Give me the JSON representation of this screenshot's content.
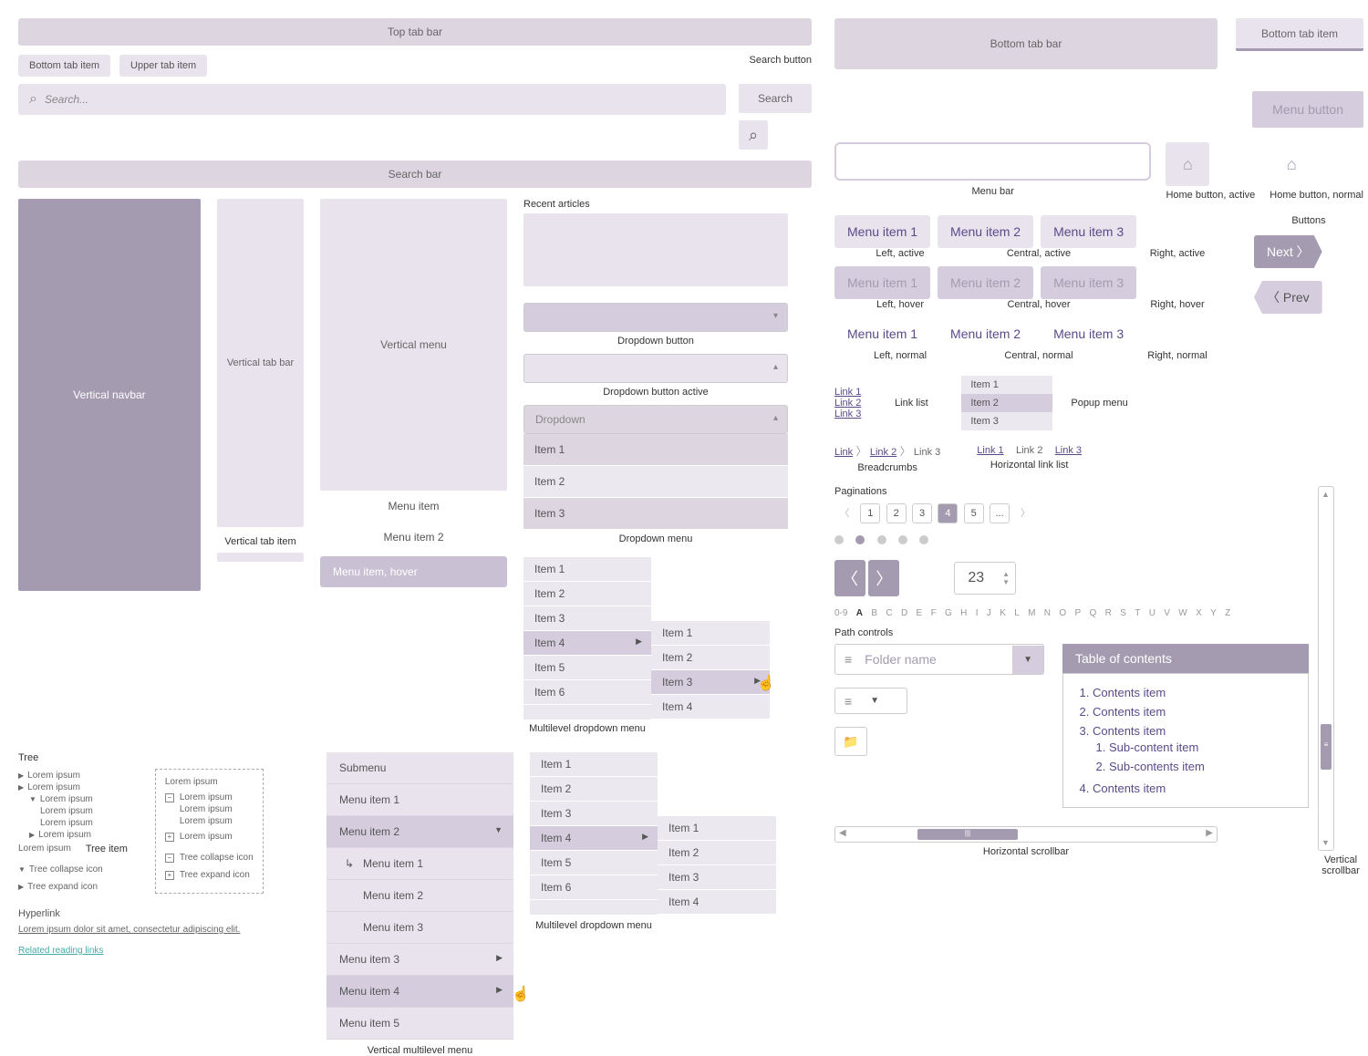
{
  "topTabBar": "Top tab bar",
  "bottomTabItem": "Bottom tab item",
  "upperTabItem": "Upper tab item",
  "searchButtonLabel": "Search button",
  "searchPlaceholder": "Search...",
  "searchBtn": "Search",
  "searchBar": "Search bar",
  "recentArticles": "Recent articles",
  "verticalNavbar": "Vertical navbar",
  "verticalTabBar": "Vertical tab bar",
  "verticalTabItem": "Vertical tab item",
  "verticalMenu": "Vertical menu",
  "menuItem": "Menu item",
  "menuItem2": "Menu item 2",
  "menuItemHover": "Menu item, hover",
  "treeLabel": "Tree",
  "treeItemLabel": "Tree item",
  "loremShort": "Lorem ipsum",
  "treeCollapseIcon": "Tree collapse icon",
  "treeExpandIcon": "Tree expand icon",
  "hyperlinkLabel": "Hyperlink",
  "loremLong": "Lorem ipsum dolor sit amet, consectetur adipiscing elit.",
  "relatedReading": "Related reading links",
  "submenu": "Submenu",
  "vml": {
    "i1": "Menu item 1",
    "i2": "Menu item 2",
    "s1": "Menu item 1",
    "s2": "Menu item 2",
    "s3": "Menu item 3",
    "i3": "Menu item 3",
    "i4": "Menu item 4",
    "i5": "Menu item 5"
  },
  "vmlLabel": "Vertical multilevel menu",
  "ddButton": "Dropdown button",
  "ddButtonActive": "Dropdown button active",
  "ddText": "Dropdown",
  "ddm": {
    "i1": "Item 1",
    "i2": "Item 2",
    "i3": "Item 3"
  },
  "ddmLabel": "Dropdown menu",
  "mlist": {
    "i1": "Item 1",
    "i2": "Item 2",
    "i3": "Item 3",
    "i4": "Item 4",
    "i5": "Item 5",
    "i6": "Item 6"
  },
  "mldd1Label": "Multilevel dropdown menu",
  "mldd2Label": "Multilevel dropdown menu",
  "bottomTabBar": "Bottom tab bar",
  "bottomTabItem2": "Bottom tab item",
  "menuButton": "Menu button",
  "menuBar": "Menu bar",
  "homeActive": "Home button, active",
  "homeNormal": "Home button, normal",
  "mi1": "Menu item 1",
  "mi2": "Menu item 2",
  "mi3": "Menu item 3",
  "leftActive": "Left, active",
  "centralActive": "Central, active",
  "rightActive": "Right, active",
  "leftHover": "Left, hover",
  "centralHover": "Central, hover",
  "rightHover": "Right, hover",
  "leftNormal": "Left, normal",
  "centralNormal": "Central, normal",
  "rightNormal": "Right, normal",
  "buttonsLabel": "Buttons",
  "nextBtn": "Next",
  "prevBtn": "Prev",
  "link1": "Link 1",
  "link2": "Link 2",
  "link3": "Link 3",
  "linkList": "Link list",
  "popupItem1": "Item 1",
  "popupItem2": "Item 2",
  "popupItem3": "Item 3",
  "popupMenu": "Popup menu",
  "bcLink": "Link",
  "bcLink2": "Link 2",
  "bcLink3": "Link 3",
  "breadcrumbs": "Breadcrumbs",
  "hLinkList": "Horizontal link list",
  "paginations": "Paginations",
  "pg": {
    "p1": "1",
    "p2": "2",
    "p3": "3",
    "p4": "4",
    "p5": "5",
    "pell": "..."
  },
  "stepperVal": "23",
  "alpha": {
    "a0": "0-9",
    "A": "A",
    "B": "B",
    "C": "C",
    "D": "D",
    "E": "E",
    "F": "F",
    "G": "G",
    "H": "H",
    "I": "I",
    "J": "J",
    "K": "K",
    "L": "L",
    "M": "M",
    "N": "N",
    "O": "O",
    "P": "P",
    "Q": "Q",
    "R": "R",
    "S": "S",
    "T": "T",
    "U": "U",
    "V": "V",
    "W": "W",
    "X": "X",
    "Y": "Y",
    "Z": "Z"
  },
  "pathControls": "Path controls",
  "folderName": "Folder name",
  "tocHeader": "Table of contents",
  "toc": {
    "c1": "Contents item",
    "c2": "Contents item",
    "c3": "Contents item",
    "s1": "Sub-content item",
    "s2": "Sub-contents item",
    "c4": "Contents item"
  },
  "hScrollLabel": "Horizontal scrollbar",
  "vScrollLabel": "Vertical scrollbar"
}
